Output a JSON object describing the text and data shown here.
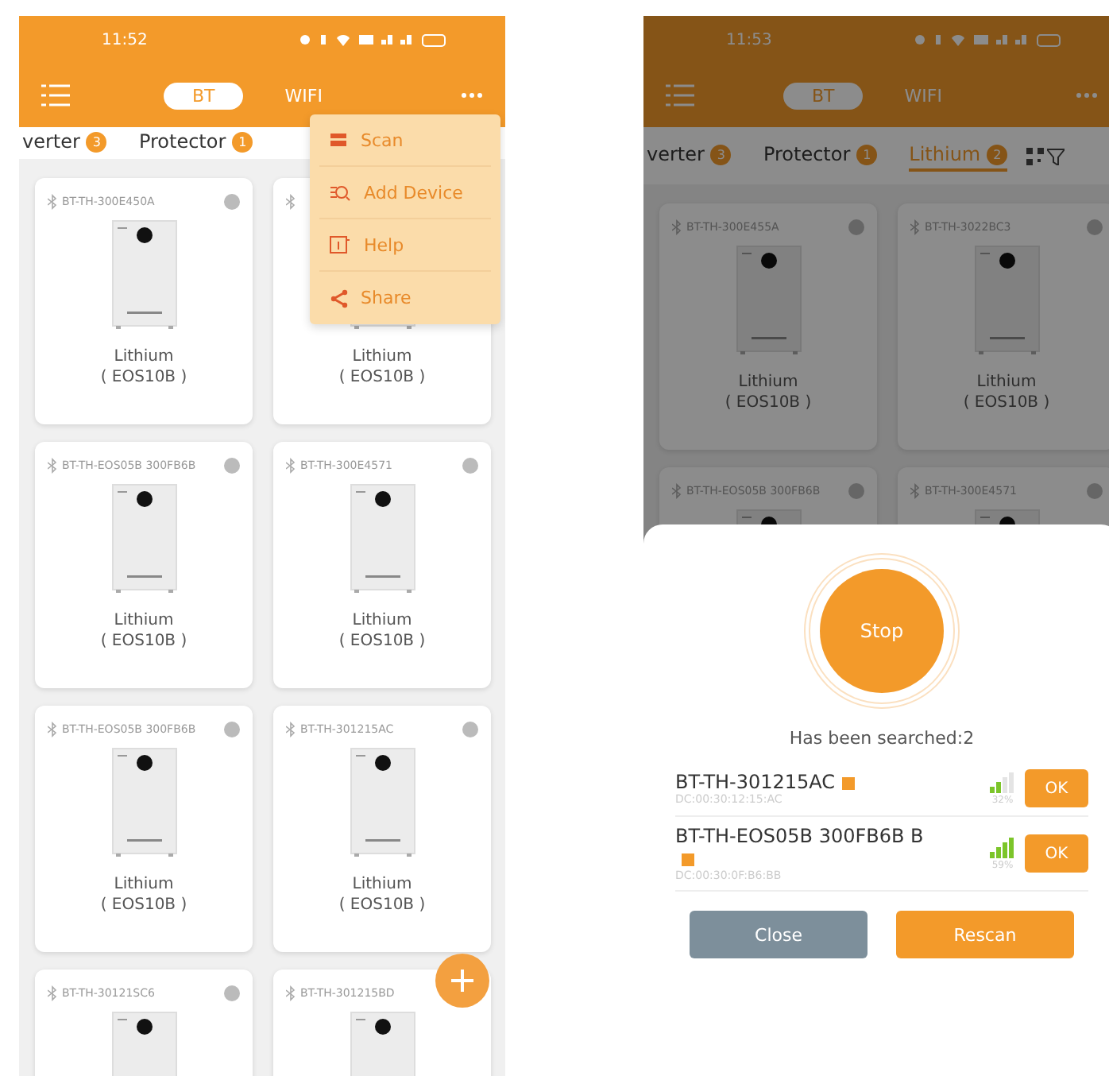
{
  "screens": [
    {
      "status_time": "11:52",
      "dimmed": false,
      "add_button": true,
      "mode_tabs": [
        {
          "label": "BT",
          "selected": true
        },
        {
          "label": "WIFI",
          "selected": false
        }
      ],
      "categories": [
        {
          "label": "verter",
          "count": "3",
          "selected": false
        },
        {
          "label": "Protector",
          "count": "1",
          "selected": false
        }
      ],
      "menu": [
        {
          "label": "Scan",
          "kind": "scan"
        },
        {
          "label": "Add Device",
          "kind": "add"
        },
        {
          "label": "Help",
          "kind": "help"
        },
        {
          "label": "Share",
          "kind": "share"
        }
      ],
      "cards": [
        {
          "device_id": "BT-TH-300E450A",
          "name": "Lithium",
          "model": "( EOS10B )"
        },
        {
          "name": "Lithium",
          "model": "( EOS10B )"
        },
        {
          "device_id": "BT-TH-EOS05B 300FB6B",
          "name": "Lithium",
          "model": "( EOS10B )"
        },
        {
          "device_id": "BT-TH-300E4571",
          "name": "Lithium",
          "model": "( EOS10B )"
        },
        {
          "device_id": "BT-TH-EOS05B 300FB6B",
          "name": "Lithium",
          "model": "( EOS10B )"
        },
        {
          "device_id": "BT-TH-301215AC",
          "name": "Lithium",
          "model": "( EOS10B )"
        },
        {
          "device_id": "BT-TH-30121SC6"
        },
        {
          "device_id": "BT-TH-301215BD"
        }
      ]
    },
    {
      "status_time": "11:53",
      "dimmed": true,
      "add_button": false,
      "mode_tabs": [
        {
          "label": "BT",
          "selected": true
        },
        {
          "label": "WIFI",
          "selected": false
        }
      ],
      "categories": [
        {
          "label": "verter",
          "count": "3",
          "selected": false
        },
        {
          "label": "Protector",
          "count": "1",
          "selected": false
        },
        {
          "label": "Lithium",
          "count": "2",
          "selected": true
        }
      ],
      "cards": [
        {
          "device_id": "BT-TH-300E455A",
          "name": "Lithium",
          "model": "( EOS10B )"
        },
        {
          "device_id": "BT-TH-3022BC3",
          "name": "Lithium",
          "model": "( EOS10B )"
        },
        {
          "device_id": "BT-TH-EOS05B 300FB6B"
        },
        {
          "device_id": "BT-TH-300E4571"
        }
      ],
      "scan_sheet": {
        "stop_label": "Stop",
        "found_text": "Has been searched:2",
        "results": [
          {
            "name": "BT-TH-301215AC",
            "mac": "DC:00:30:12:15:AC",
            "signal": "32%",
            "strong": false,
            "button": "OK"
          },
          {
            "name": "BT-TH-EOS05B 300FB6B B",
            "mac": "DC:00:30:0F:B6:BB",
            "signal": "59%",
            "strong": true,
            "button": "OK"
          }
        ],
        "buttons": [
          {
            "label": "Close",
            "kind": "secondary"
          },
          {
            "label": "Rescan",
            "kind": "primary"
          }
        ]
      }
    }
  ]
}
